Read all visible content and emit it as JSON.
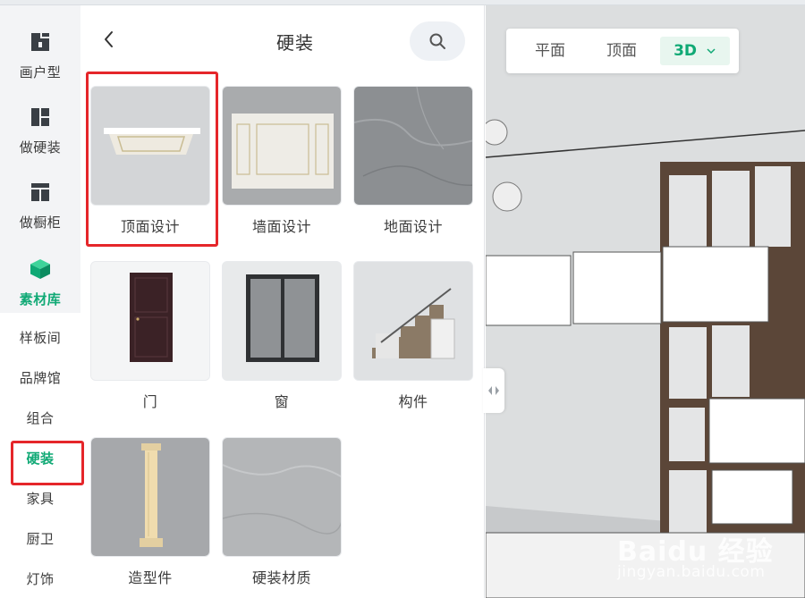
{
  "nav": {
    "tools": [
      {
        "label": "画户型",
        "icon": "floorplan-icon"
      },
      {
        "label": "做硬装",
        "icon": "layout-icon"
      },
      {
        "label": "做橱柜",
        "icon": "cabinet-icon"
      },
      {
        "label": "素材库",
        "icon": "cube-icon"
      }
    ],
    "subs": [
      "样板间",
      "品牌馆",
      "组合",
      "硬装",
      "家具",
      "厨卫",
      "灯饰"
    ],
    "active_sub": "硬装"
  },
  "panel": {
    "title": "硬装",
    "cards": [
      {
        "label": "顶面设计"
      },
      {
        "label": "墙面设计"
      },
      {
        "label": "地面设计"
      },
      {
        "label": "门"
      },
      {
        "label": "窗"
      },
      {
        "label": "构件"
      },
      {
        "label": "造型件"
      },
      {
        "label": "硬装材质"
      }
    ]
  },
  "view": {
    "modes": [
      "平面",
      "顶面",
      "3D"
    ],
    "active_mode": "3D"
  },
  "watermark": {
    "main": "Baidu 经验",
    "sub": "jingyan.baidu.com"
  },
  "colors": {
    "accent": "#10a975",
    "highlight": "#e5262a"
  }
}
